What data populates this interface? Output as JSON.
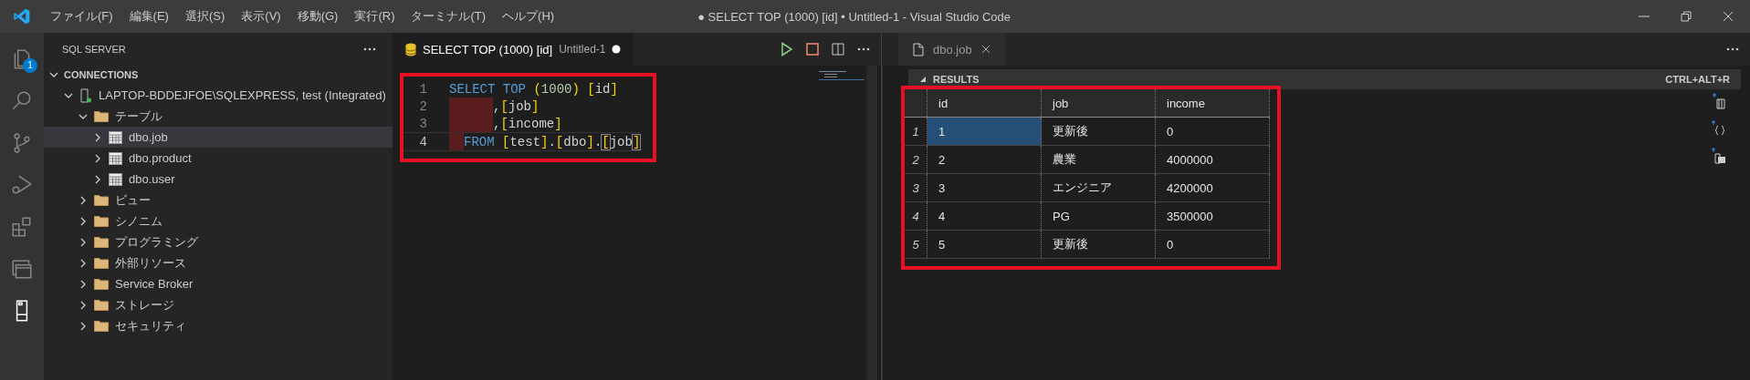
{
  "window": {
    "title": "● SELECT TOP (1000) [id] • Untitled-1 - Visual Studio Code"
  },
  "menu": [
    "ファイル(F)",
    "編集(E)",
    "選択(S)",
    "表示(V)",
    "移動(G)",
    "実行(R)",
    "ターミナル(T)",
    "ヘルプ(H)"
  ],
  "activity_bar": [
    {
      "kind": "files",
      "selected": false,
      "badge": "1"
    },
    {
      "kind": "search",
      "selected": false
    },
    {
      "kind": "source-control",
      "selected": false
    },
    {
      "kind": "debug",
      "selected": false
    },
    {
      "kind": "extensions",
      "selected": false
    },
    {
      "kind": "windows",
      "selected": false
    },
    {
      "kind": "server",
      "selected": true
    }
  ],
  "sidebar": {
    "title": "SQL SERVER",
    "section": "CONNECTIONS",
    "items": [
      {
        "label": "LAPTOP-BDDEJFOE\\SQLEXPRESS, test (Integrated)",
        "kind": "server",
        "expanded": true,
        "selected": false,
        "children": [
          {
            "label": "テーブル",
            "kind": "folder",
            "expanded": true,
            "selected": false,
            "children": [
              {
                "label": "dbo.job",
                "kind": "table",
                "expanded": false,
                "selected": true
              },
              {
                "label": "dbo.product",
                "kind": "table",
                "expanded": false,
                "selected": false
              },
              {
                "label": "dbo.user",
                "kind": "table",
                "expanded": false,
                "selected": false
              }
            ]
          },
          {
            "label": "ビュー",
            "kind": "folder",
            "expanded": false,
            "selected": false
          },
          {
            "label": "シノニム",
            "kind": "folder",
            "expanded": false,
            "selected": false
          },
          {
            "label": "プログラミング",
            "kind": "folder",
            "expanded": false,
            "selected": false
          },
          {
            "label": "外部リソース",
            "kind": "folder",
            "expanded": false,
            "selected": false
          },
          {
            "label": "Service Broker",
            "kind": "folder",
            "expanded": false,
            "selected": false
          },
          {
            "label": "ストレージ",
            "kind": "folder",
            "expanded": false,
            "selected": false
          },
          {
            "label": "セキュリティ",
            "kind": "folder",
            "expanded": false,
            "selected": false
          }
        ]
      }
    ]
  },
  "editor": {
    "tab": {
      "title": "SELECT TOP (1000) [id]",
      "description": "Untitled-1",
      "modified": true
    },
    "annotated": true,
    "lines": [
      {
        "number": "1",
        "current": false,
        "marked_indent": false,
        "tokens": [
          {
            "text": "SELECT TOP ",
            "kind": "keyword"
          },
          {
            "text": "(",
            "kind": "paren"
          },
          {
            "text": "1000",
            "kind": "number"
          },
          {
            "text": ") ",
            "kind": "paren"
          },
          {
            "text": "[",
            "kind": "bracket"
          },
          {
            "text": "id",
            "kind": "ident"
          },
          {
            "text": "]",
            "kind": "bracket"
          }
        ]
      },
      {
        "number": "2",
        "current": false,
        "marked_indent": true,
        "tokens": [
          {
            "text": ",",
            "kind": "plain"
          },
          {
            "text": "[",
            "kind": "bracket"
          },
          {
            "text": "job",
            "kind": "ident"
          },
          {
            "text": "]",
            "kind": "bracket"
          }
        ]
      },
      {
        "number": "3",
        "current": false,
        "marked_indent": true,
        "tokens": [
          {
            "text": ",",
            "kind": "plain"
          },
          {
            "text": "[",
            "kind": "bracket"
          },
          {
            "text": "income",
            "kind": "ident"
          },
          {
            "text": "]",
            "kind": "bracket"
          }
        ]
      },
      {
        "number": "4",
        "current": true,
        "marked_indent": true,
        "tokens": [
          {
            "text": "FROM ",
            "kind": "keyword"
          },
          {
            "text": "[",
            "kind": "bracket"
          },
          {
            "text": "test",
            "kind": "ident"
          },
          {
            "text": "]",
            "kind": "bracket"
          },
          {
            "text": ".",
            "kind": "plain"
          },
          {
            "text": "[",
            "kind": "bracket"
          },
          {
            "text": "dbo",
            "kind": "ident"
          },
          {
            "text": "]",
            "kind": "bracket"
          },
          {
            "text": ".",
            "kind": "plain"
          },
          {
            "text": "[",
            "kind": "match"
          },
          {
            "text": "job",
            "kind": "ident"
          },
          {
            "text": "]",
            "kind": "match"
          }
        ]
      }
    ]
  },
  "results": {
    "tab": {
      "title": "dbo.job"
    },
    "header": "RESULTS",
    "shortcut": "CTRL+ALT+R",
    "annotated": true,
    "columns": [
      "id",
      "job",
      "income"
    ],
    "rows": [
      {
        "number": "1",
        "cells": [
          {
            "text": "1",
            "selected": true
          },
          {
            "text": "更新後",
            "selected": false
          },
          {
            "text": "0",
            "selected": false
          }
        ]
      },
      {
        "number": "2",
        "cells": [
          {
            "text": "2",
            "selected": false
          },
          {
            "text": "農業",
            "selected": false
          },
          {
            "text": "4000000",
            "selected": false
          }
        ]
      },
      {
        "number": "3",
        "cells": [
          {
            "text": "3",
            "selected": false
          },
          {
            "text": "エンジニア",
            "selected": false
          },
          {
            "text": "4200000",
            "selected": false
          }
        ]
      },
      {
        "number": "4",
        "cells": [
          {
            "text": "4",
            "selected": false
          },
          {
            "text": "PG",
            "selected": false
          },
          {
            "text": "3500000",
            "selected": false
          }
        ]
      },
      {
        "number": "5",
        "cells": [
          {
            "text": "5",
            "selected": false
          },
          {
            "text": "更新後",
            "selected": false
          },
          {
            "text": "0",
            "selected": false
          }
        ]
      }
    ]
  }
}
